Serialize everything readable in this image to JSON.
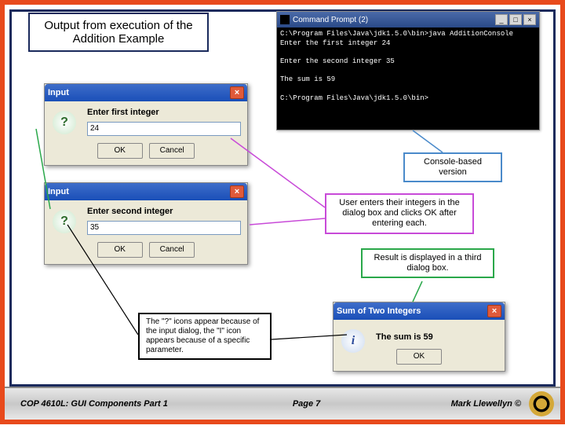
{
  "title": "Output from execution of the Addition Example",
  "console": {
    "title": "Command Prompt (2)",
    "lines": "C:\\Program Files\\Java\\jdk1.5.0\\bin>java AdditionConsole\nEnter the first integer 24\n\nEnter the second integer 35\n\nThe sum is 59\n\nC:\\Program Files\\Java\\jdk1.5.0\\bin>"
  },
  "dialog1": {
    "title": "Input",
    "label": "Enter first integer",
    "value": "24",
    "ok": "OK",
    "cancel": "Cancel"
  },
  "dialog2": {
    "title": "Input",
    "label": "Enter second integer",
    "value": "35",
    "ok": "OK",
    "cancel": "Cancel"
  },
  "dialog3": {
    "title": "Sum of Two Integers",
    "label": "The sum is 59",
    "ok": "OK"
  },
  "callouts": {
    "console": "Console-based version",
    "user_enters": "User enters their integers in the dialog box and clicks OK after entering each.",
    "result": "Result is displayed in a third dialog box.",
    "icons_explain": "The \"?\" icons appear because of the input dialog, the \"I\" icon appears because of a specific parameter."
  },
  "footer": {
    "left": "COP 4610L: GUI Components Part 1",
    "center": "Page 7",
    "right": "Mark Llewellyn ©"
  }
}
